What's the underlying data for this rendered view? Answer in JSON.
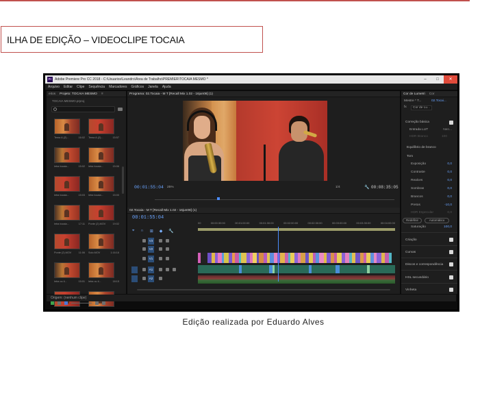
{
  "document": {
    "heading": "ILHA DE EDIÇÃO – VIDEOCLIPE TOCAIA",
    "caption": "Edição realizada por Eduardo Alves"
  },
  "app": {
    "title": "Adobe Premiere Pro CC 2018 - C:\\Usuarios\\Leandro\\Área de Trabalho\\PREMIER\\TOCAIA MESMO *",
    "logo": "Pr",
    "close_tooltip": "Fechar",
    "menu": [
      "Arquivo",
      "Editar",
      "Clipe",
      "Sequência",
      "Marcadores",
      "Gráficos",
      "Janela",
      "Ajuda"
    ],
    "window_controls": {
      "minimize": "–",
      "maximize": "□",
      "close": "✕"
    }
  },
  "project_panel": {
    "tabs": [
      "eitos",
      "Projeto: TOCAIA MESMO",
      "≡"
    ],
    "path": "TOCAIA MESMO.prproj",
    "thumbnails": [
      {
        "label": "Tema A.(2)...",
        "duration": "16:02"
      },
      {
        "label": "Tema A.(2)...",
        "duration": "15:57"
      },
      {
        "label": "letra tocaia...",
        "duration": "15:02"
      },
      {
        "label": "letra tocaia...",
        "duration": "15:06"
      },
      {
        "label": "letra tocaia...",
        "duration": "15:03"
      },
      {
        "label": "letra tocaia...",
        "duration": "15:00"
      },
      {
        "label": "letra tocaia...",
        "duration": "17:11"
      },
      {
        "label": "Ponte (2).MOV",
        "duration": "19:02"
      },
      {
        "label": "Ponte (2).MOV",
        "duration": "11:06"
      },
      {
        "label": "Solo.MOV",
        "duration": "1:16:16"
      },
      {
        "label": "letra ou il...",
        "duration": "15:01"
      },
      {
        "label": "letra ou il...",
        "duration": "18:15"
      },
      {
        "label": "...",
        "duration": ""
      },
      {
        "label": "...",
        "duration": ""
      }
    ]
  },
  "program_monitor": {
    "tab": "Programa: 02.Tocaia - M T [Recall Mix 1.02 - 16jun08] (1)",
    "timecode": "00:01:55:04",
    "zoom": "25%",
    "fraction": "1/4",
    "duration": "00:08:35:05",
    "transport": [
      "▾",
      "{",
      "}",
      "|◂",
      "◂|",
      "▶",
      "|▸",
      "▸|",
      "⊓",
      "⊔",
      "⌑",
      "⧉",
      "+"
    ]
  },
  "timeline": {
    "tab": "02.Tocaia - M T [Recall Mix 1.02 - 16jun08] (1)",
    "timecode": "00:01:55:04",
    "ruler": [
      "00",
      "00:00:30:00",
      "00:01:00:00",
      "00:01:30:00",
      "00:02:00:00",
      "00:02:30:00",
      "00:03:00:00",
      "00:03:30:00",
      "00:04:00:00"
    ],
    "tools": [
      "⌖",
      "∩",
      "⊞",
      "◆",
      "🔧"
    ],
    "tracks": [
      "V3",
      "V2",
      "V1",
      "A1",
      "A2"
    ]
  },
  "lumetri": {
    "tab": "Cor de Lumetri",
    "tab2": "Cor",
    "mestre": "Mestre * T...",
    "clip": "02.Tocai...",
    "fx_label": "fx",
    "fx_dropdown": "Cor de Lu...",
    "sections": {
      "basic": "Correção básica",
      "input_lut": "Entrada LUT",
      "input_lut_value": "Nen...",
      "hdr": "HDR Branco",
      "hdr_value": "100",
      "white_balance": "Equilíbrio de branco",
      "tone": "Tom",
      "rows": [
        {
          "name": "Exposição",
          "value": "0,0"
        },
        {
          "name": "Contraste",
          "value": "0,0"
        },
        {
          "name": "Realces",
          "value": "0,0"
        },
        {
          "name": "Sombras",
          "value": "0,0"
        },
        {
          "name": "Brancos",
          "value": "0,0"
        },
        {
          "name": "Pretos",
          "value": "-10,0"
        },
        {
          "name": "HDR Especular",
          "value": "0,0"
        }
      ],
      "reset": "Redefinir",
      "auto": "Automático",
      "saturation": "Saturação",
      "saturation_value": "100,0",
      "creative": "Criação",
      "curves": "Curvas",
      "wheels": "Discos e correspondência",
      "hsl": "HSL secundário",
      "vignette": "Vinheta"
    }
  },
  "source_panel": {
    "label": "Origem: (nenhum clipe)"
  },
  "colors": {
    "accent_blue": "#4b8dff",
    "border_red": "#c0504d",
    "panel_bg": "#1e1e1e"
  }
}
